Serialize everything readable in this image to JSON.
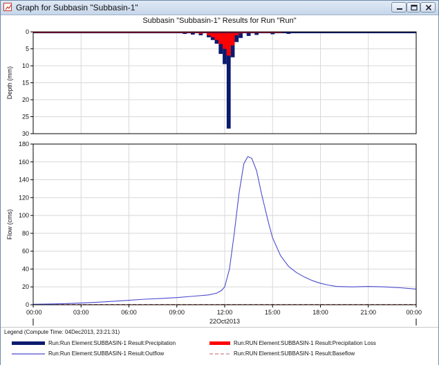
{
  "window": {
    "title": "Graph for Subbasin \"Subbasin-1\"",
    "controls": [
      "minimize",
      "maximize",
      "close"
    ]
  },
  "chart": {
    "title": "Subbasin \"Subbasin-1\" Results for Run \"Run\""
  },
  "chart_data": [
    {
      "type": "bar",
      "title": "Subbasin \"Subbasin-1\" Results for Run \"Run\"",
      "ylabel": "Depth (mm)",
      "y_inverted": true,
      "ylim": [
        0,
        30
      ],
      "yticks": [
        "0",
        "5",
        "10",
        "15",
        "20",
        "25",
        "30"
      ],
      "grid": true,
      "x_hours": [
        9.5,
        10.0,
        10.5,
        11.0,
        11.25,
        11.5,
        11.75,
        12.0,
        12.25,
        12.5,
        12.75,
        13.0,
        13.5,
        14.0,
        15.0,
        16.0
      ],
      "series": [
        {
          "name": "Run:Run Element:SUBBASIN-1 Result:Precipitation",
          "color": "#0b1a6e",
          "values": [
            0.6,
            0.8,
            1.0,
            1.6,
            2.4,
            3.5,
            6.5,
            9.5,
            28.5,
            7.5,
            3.0,
            1.8,
            1.2,
            0.9,
            0.7,
            0.6
          ]
        },
        {
          "name": "Run:RUN Element:SUBBASIN-1 Result:Precipitation Loss",
          "color": "#ff0000",
          "values": [
            0.3,
            0.4,
            0.6,
            1.0,
            1.6,
            2.4,
            3.6,
            5.0,
            7.0,
            4.0,
            1.0,
            0.5,
            0.3,
            0.2,
            0.15,
            0.15
          ]
        }
      ]
    },
    {
      "type": "line",
      "ylabel": "Flow (cms)",
      "ylim": [
        0,
        180
      ],
      "yticks": [
        "0",
        "20",
        "40",
        "60",
        "80",
        "100",
        "120",
        "140",
        "160",
        "180"
      ],
      "xlim_hours": [
        0,
        24
      ],
      "xticks": [
        "00:00",
        "03:00",
        "06:00",
        "09:00",
        "12:00",
        "15:00",
        "18:00",
        "21:00",
        "00:00"
      ],
      "xdate": "22Oct2013",
      "grid": true,
      "series": [
        {
          "name": "Run:Run Element:SUBBASIN-1 Result:Outflow",
          "color": "#4a4ad0",
          "x": [
            0,
            1,
            2,
            3,
            4,
            5,
            6,
            7,
            8,
            9,
            10,
            11,
            11.5,
            11.8,
            12.0,
            12.3,
            12.6,
            12.9,
            13.2,
            13.45,
            13.7,
            14.0,
            14.3,
            14.7,
            15.0,
            15.5,
            16.0,
            16.5,
            17.0,
            17.5,
            18.0,
            18.5,
            19.0,
            20.0,
            21.0,
            22.0,
            23.0,
            24.0
          ],
          "y": [
            0.5,
            0.8,
            1.2,
            2.0,
            2.8,
            3.8,
            5.0,
            6.2,
            7.0,
            8.0,
            9.5,
            11.0,
            13.0,
            16.0,
            20.0,
            40.0,
            80.0,
            125.0,
            158.0,
            166.0,
            164.0,
            150.0,
            125.0,
            95.0,
            75.0,
            55.0,
            43.0,
            36.0,
            31.0,
            27.0,
            24.0,
            22.0,
            20.5,
            20.0,
            20.5,
            20.0,
            19.0,
            17.5
          ]
        },
        {
          "name": "Run:RUN Element:SUBBASIN-1 Result:Baseflow",
          "color": "#c06060",
          "x": [
            0,
            24
          ],
          "y": [
            0,
            0
          ]
        }
      ]
    }
  ],
  "legend": {
    "title": "Legend (Compute Time: 04Dec2013, 23:21:31)",
    "items": [
      {
        "label": "Run:Run Element:SUBBASIN-1 Result:Precipitation",
        "style": "thick-bar",
        "color": "#0b1a6e"
      },
      {
        "label": "Run:RUN Element:SUBBASIN-1 Result:Precipitation Loss",
        "style": "thick-bar",
        "color": "#ff0000"
      },
      {
        "label": "Run:Run Element:SUBBASIN-1 Result:Outflow",
        "style": "line",
        "color": "#4a4ad0"
      },
      {
        "label": "Run:RUN Element:SUBBASIN-1 Result:Baseflow",
        "style": "dashed",
        "color": "#c06060"
      }
    ]
  }
}
